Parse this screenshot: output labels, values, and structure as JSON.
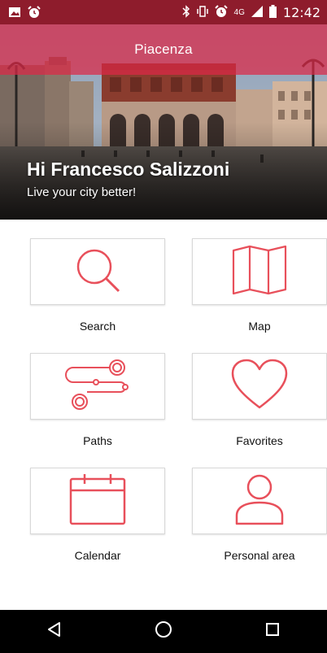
{
  "status_bar": {
    "time": "12:42",
    "network": "4G",
    "icons": [
      "image-icon",
      "alarm-icon",
      "bluetooth-icon",
      "vibrate-icon",
      "alarm-icon",
      "signal-icon",
      "battery-icon"
    ]
  },
  "header": {
    "city": "Piacenza",
    "greeting": "Hi Francesco Salizzoni",
    "tagline": "Live your city better!"
  },
  "tiles": [
    {
      "label": "Search",
      "icon": "search-icon"
    },
    {
      "label": "Map",
      "icon": "map-icon"
    },
    {
      "label": "Paths",
      "icon": "paths-icon"
    },
    {
      "label": "Favorites",
      "icon": "heart-icon"
    },
    {
      "label": "Calendar",
      "icon": "calendar-icon"
    },
    {
      "label": "Personal area",
      "icon": "person-icon"
    }
  ],
  "colors": {
    "accent": "#e8505b",
    "status_bar": "#8e1c2c",
    "title_overlay": "#dc2846"
  }
}
